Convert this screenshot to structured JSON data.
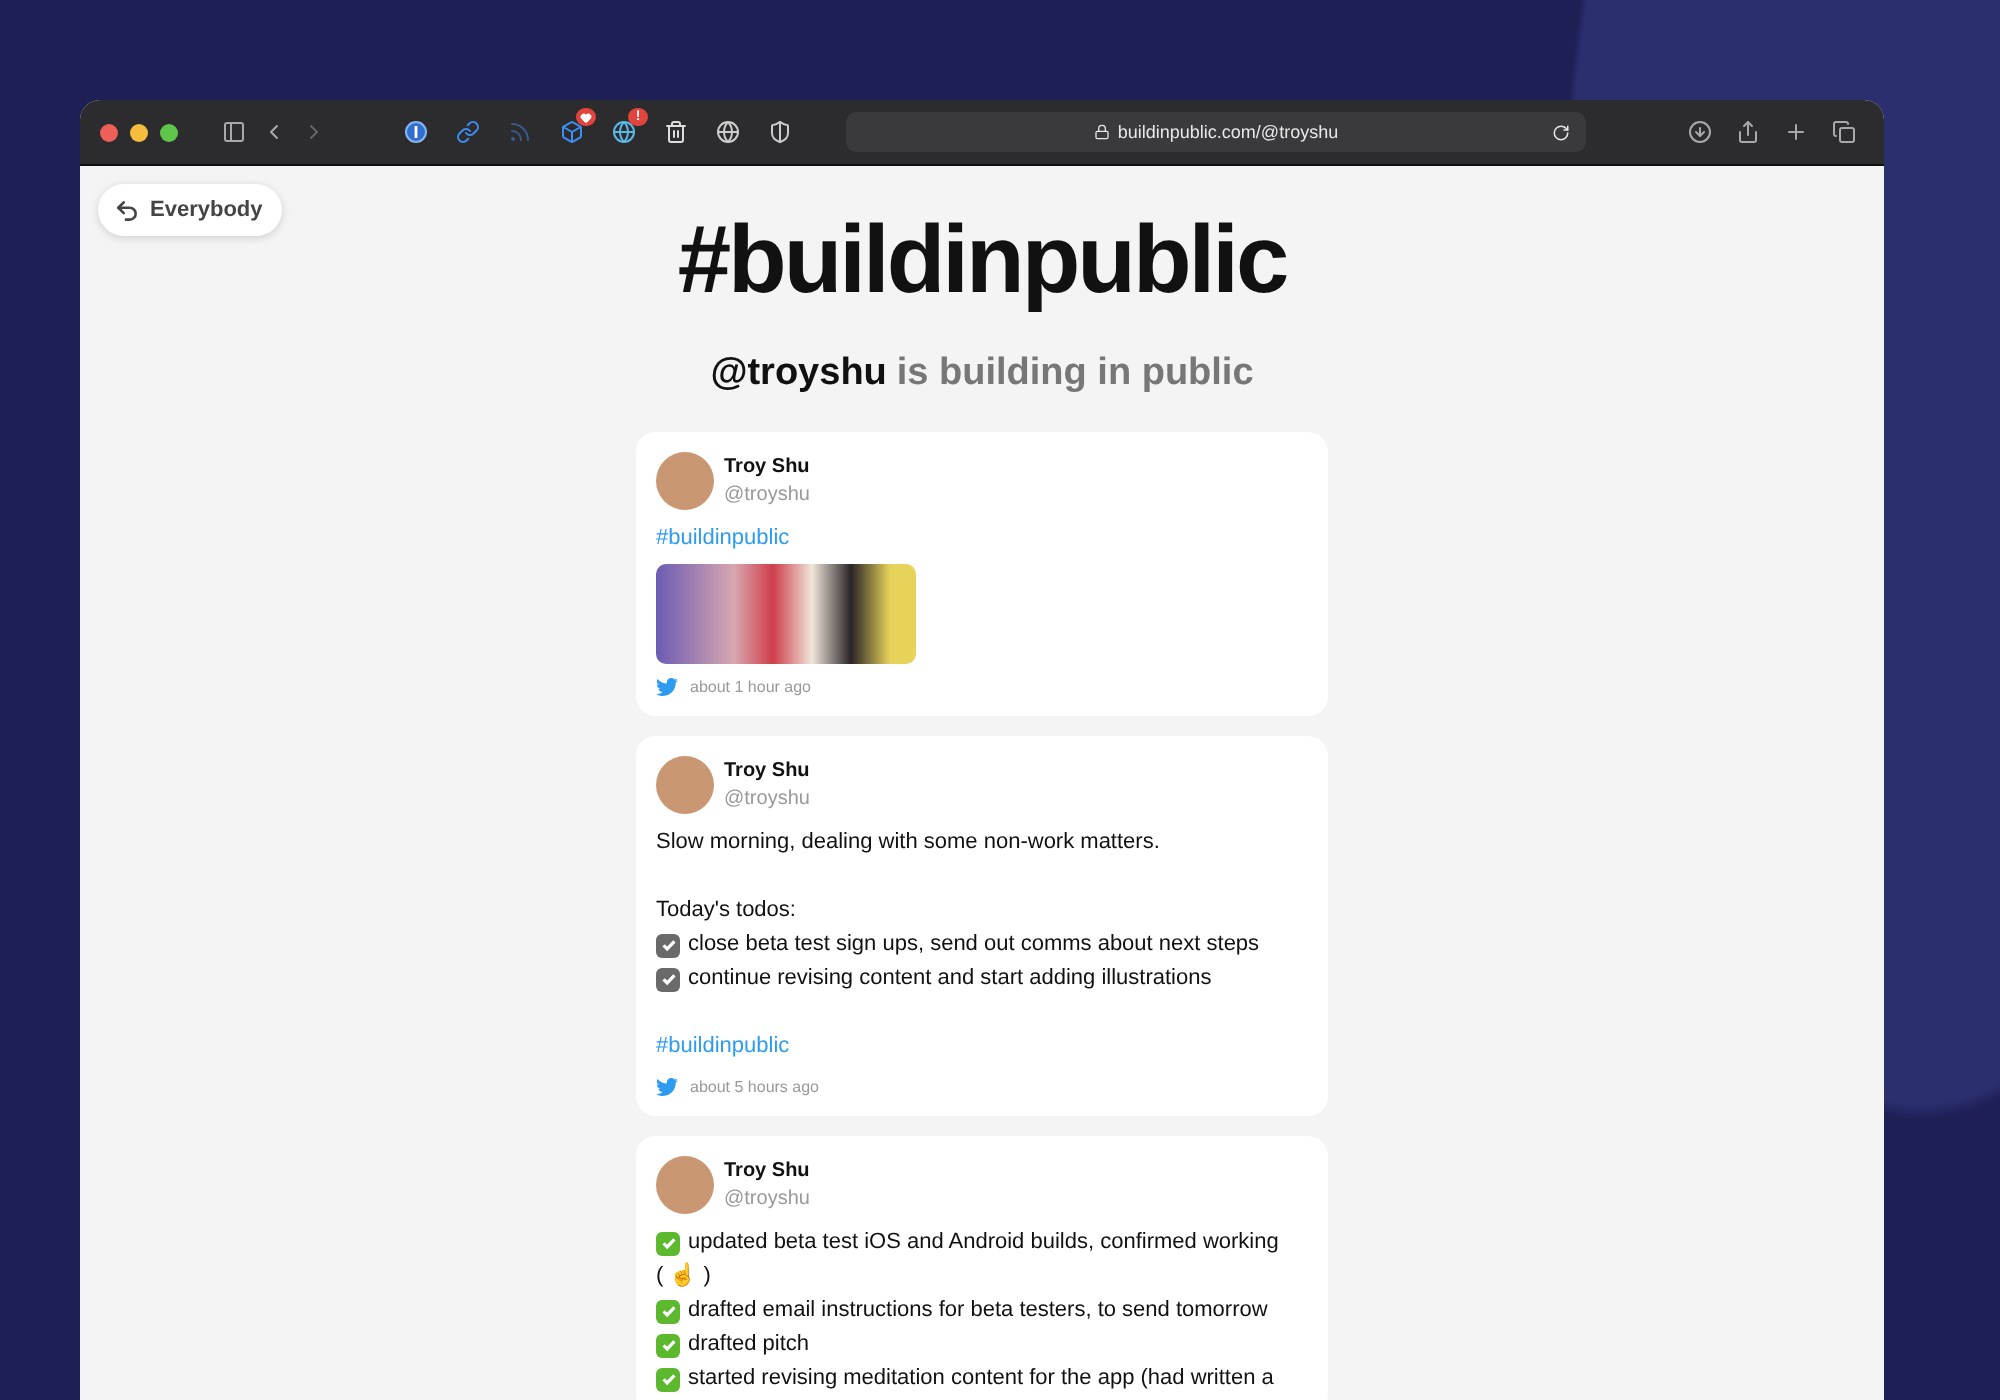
{
  "browser": {
    "url": "buildinpublic.com/@troyshu",
    "extension_badge": "!"
  },
  "back_button": {
    "label": "Everybody"
  },
  "title": "#buildinpublic",
  "subtitle": {
    "handle": "@troyshu",
    "rest": "is building in public"
  },
  "tweets": [
    {
      "name": "Troy Shu",
      "handle": "@troyshu",
      "has_photo": true,
      "time": "about 1 hour ago",
      "lines": [
        {
          "kind": "hashtag",
          "text": "#buildinpublic"
        }
      ]
    },
    {
      "name": "Troy Shu",
      "handle": "@troyshu",
      "has_photo": false,
      "time": "about 5 hours ago",
      "lines": [
        {
          "kind": "text",
          "text": "Slow morning, dealing with some non-work matters."
        },
        {
          "kind": "blank"
        },
        {
          "kind": "text",
          "text": "Today's todos:"
        },
        {
          "kind": "check",
          "text": "close beta test sign ups, send out comms about next steps"
        },
        {
          "kind": "check",
          "text": "continue revising content and start adding illustrations"
        },
        {
          "kind": "blank"
        },
        {
          "kind": "hashtag",
          "text": "#buildinpublic"
        }
      ]
    },
    {
      "name": "Troy Shu",
      "handle": "@troyshu",
      "has_photo": false,
      "lines": [
        {
          "kind": "done",
          "text": "updated beta test iOS and Android builds, confirmed working"
        },
        {
          "kind": "text",
          "text": "( ☝ )"
        },
        {
          "kind": "done",
          "text": "drafted email instructions for beta testers, to send tomorrow"
        },
        {
          "kind": "done",
          "text": "drafted pitch"
        },
        {
          "kind": "done",
          "text": "started revising meditation content for the app (had written a"
        }
      ]
    }
  ]
}
